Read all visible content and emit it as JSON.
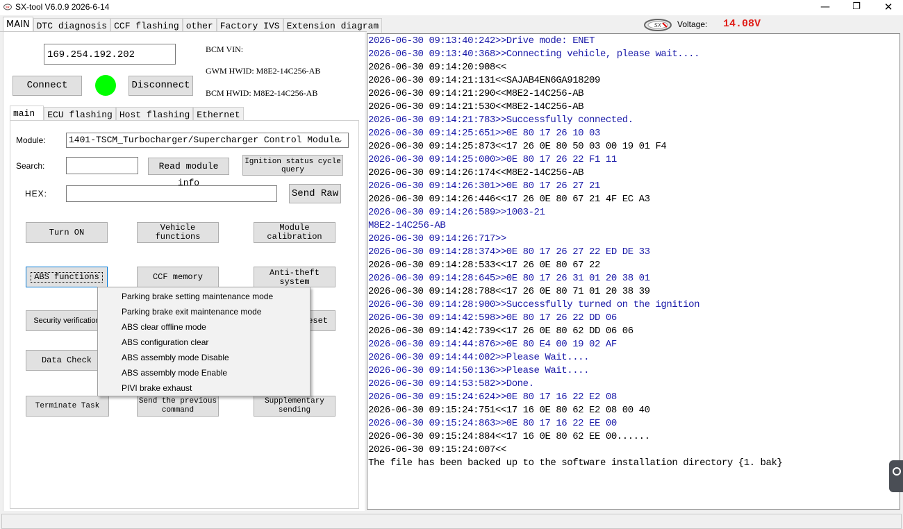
{
  "window": {
    "title": "SX-tool V6.0.9  2026-6-14",
    "min_icon": "minimize-icon",
    "max_icon": "maximize-icon",
    "close_icon": "close-icon"
  },
  "top_tabs": [
    "MAIN",
    "DTC diagnosis",
    "CCF flashing",
    "other",
    "Factory IVS",
    "Extension diagram"
  ],
  "voltage": {
    "label": "Voltage:",
    "value": "14.08V",
    "color": "#e0201a"
  },
  "connection": {
    "ip": "169.254.192.202",
    "connect_label": "Connect",
    "disconnect_label": "Disconnect",
    "status_color": "#00ff00",
    "bcm_vin_label": "BCM VIN:",
    "gwm_hwid_label": "GWM HWID: M8E2-14C256-AB",
    "bcm_hwid_label": "BCM HWID: M8E2-14C256-AB"
  },
  "inner_tabs": [
    "main",
    "ECU flashing",
    "Host flashing",
    "Ethernet"
  ],
  "form": {
    "module_label": "Module:",
    "module_value": "1401-TSCM_Turbocharger/Supercharger Control Module",
    "search_label": "Search:",
    "search_value": "",
    "read_module_label": "Read module info",
    "ignition_label": "Ignition status cycle query",
    "hex_label": "HEX:",
    "hex_value": "",
    "send_raw_label": "Send Raw"
  },
  "buttons": {
    "turn_on": "Turn ON",
    "vehicle_functions": "Vehicle functions",
    "module_calibration": "Module calibration",
    "abs_functions": "ABS functions",
    "ccf_memory": "CCF memory",
    "anti_theft": "Anti-theft system",
    "security_verification": "Security verification",
    "reset": "eset",
    "data_check": "Data Check",
    "terminate_task": "Terminate Task",
    "send_previous": "Send the previous command",
    "supplementary": "Supplementary sending"
  },
  "abs_menu": [
    "Parking brake setting maintenance mode",
    "Parking brake exit maintenance mode",
    "ABS clear offline mode",
    "ABS configuration clear",
    "ABS assembly mode Disable",
    "ABS assembly mode Enable",
    "PIVI brake exhaust"
  ],
  "log": [
    {
      "text": "2026-06-30 09:13:40:242>>Drive mode: ENET",
      "color": "blue"
    },
    {
      "text": "2026-06-30 09:13:40:368>>Connecting vehicle, please wait....",
      "color": "blue"
    },
    {
      "text": "2026-06-30 09:14:20:908<<",
      "color": "black"
    },
    {
      "text": "2026-06-30 09:14:21:131<<SAJAB4EN6GA918209",
      "color": "black"
    },
    {
      "text": "2026-06-30 09:14:21:290<<M8E2-14C256-AB",
      "color": "black"
    },
    {
      "text": "2026-06-30 09:14:21:530<<M8E2-14C256-AB",
      "color": "black"
    },
    {
      "text": "2026-06-30 09:14:21:783>>Successfully connected.",
      "color": "blue"
    },
    {
      "text": "2026-06-30 09:14:25:651>>0E 80 17 26 10 03",
      "color": "blue"
    },
    {
      "text": "2026-06-30 09:14:25:873<<17 26 0E 80 50 03 00 19 01 F4",
      "color": "black"
    },
    {
      "text": "2026-06-30 09:14:25:000>>0E 80 17 26 22 F1 11",
      "color": "blue"
    },
    {
      "text": "2026-06-30 09:14:26:174<<M8E2-14C256-AB",
      "color": "black"
    },
    {
      "text": "2026-06-30 09:14:26:301>>0E 80 17 26 27 21",
      "color": "blue"
    },
    {
      "text": "2026-06-30 09:14:26:446<<17 26 0E 80 67 21 4F EC A3",
      "color": "black"
    },
    {
      "text": "2026-06-30 09:14:26:589>>1003-21",
      "color": "blue"
    },
    {
      "text": "M8E2-14C256-AB",
      "color": "blue"
    },
    {
      "text": "2026-06-30 09:14:26:717>>",
      "color": "blue"
    },
    {
      "text": "2026-06-30 09:14:28:374>>0E 80 17 26 27 22 ED DE 33",
      "color": "blue"
    },
    {
      "text": "2026-06-30 09:14:28:533<<17 26 0E 80 67 22",
      "color": "black"
    },
    {
      "text": "2026-06-30 09:14:28:645>>0E 80 17 26 31 01 20 38 01",
      "color": "blue"
    },
    {
      "text": "2026-06-30 09:14:28:788<<17 26 0E 80 71 01 20 38 39",
      "color": "black"
    },
    {
      "text": "2026-06-30 09:14:28:900>>Successfully turned on the ignition",
      "color": "blue"
    },
    {
      "text": "2026-06-30 09:14:42:598>>0E 80 17 26 22 DD 06",
      "color": "blue"
    },
    {
      "text": "2026-06-30 09:14:42:739<<17 26 0E 80 62 DD 06 06",
      "color": "black"
    },
    {
      "text": "2026-06-30 09:14:44:876>>0E 80 E4 00 19 02 AF",
      "color": "blue"
    },
    {
      "text": "2026-06-30 09:14:44:002>>Please Wait....",
      "color": "blue"
    },
    {
      "text": "2026-06-30 09:14:50:136>>Please Wait....",
      "color": "blue"
    },
    {
      "text": "2026-06-30 09:14:53:582>>Done.",
      "color": "blue"
    },
    {
      "text": "2026-06-30 09:15:24:624>>0E 80 17 16 22 E2 08",
      "color": "blue"
    },
    {
      "text": "2026-06-30 09:15:24:751<<17 16 0E 80 62 E2 08 00 40",
      "color": "black"
    },
    {
      "text": "2026-06-30 09:15:24:863>>0E 80 17 16 22 EE 00",
      "color": "blue"
    },
    {
      "text": "2026-06-30 09:15:24:884<<17 16 0E 80 62 EE 00......",
      "color": "black"
    },
    {
      "text": "2026-06-30 09:15:24:007<<",
      "color": "black"
    },
    {
      "text": "The file has been backed up to the software installation directory {1. bak}",
      "color": "black"
    }
  ]
}
